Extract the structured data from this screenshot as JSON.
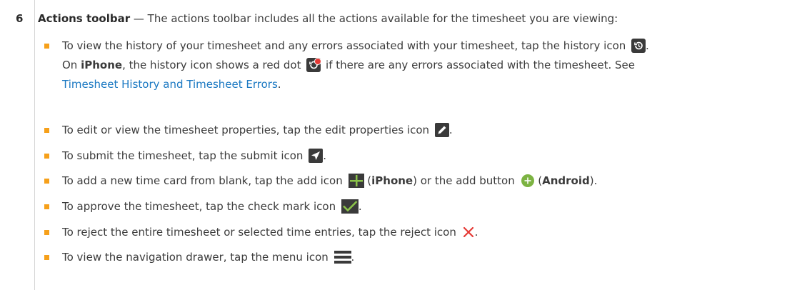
{
  "row_number": "6",
  "intro": {
    "title": "Actions toolbar",
    "rest": " — The actions toolbar includes all the actions available for the timesheet you are viewing:"
  },
  "items": {
    "history": {
      "l1": "To view the history of your timesheet and any errors associated with your timesheet, tap the history icon",
      "l1_end": ".",
      "l2_pre": "On ",
      "l2_bold": "iPhone",
      "l2_mid": ", the history icon shows a red dot",
      "l2_end": " if there are any errors associated with the timesheet. See",
      "link": "Timesheet History and Timesheet Errors",
      "l3_end": "."
    },
    "edit": {
      "text": "To edit or view the timesheet properties, tap the edit properties icon",
      "end": "."
    },
    "submit": {
      "text": "To submit the timesheet, tap the submit icon",
      "end": "."
    },
    "add": {
      "pre": "To add a new time card from blank, tap the add icon",
      "p1": " (",
      "iphone": "iPhone",
      "mid": ") or the add button",
      "p2": " (",
      "android": "Android",
      "end": ")."
    },
    "approve": {
      "text": "To approve the timesheet, tap the check mark icon",
      "end": "."
    },
    "reject": {
      "text": "To reject the entire timesheet or selected time entries, tap the reject icon",
      "end": "."
    },
    "menu": {
      "text": "To view the navigation drawer, tap the menu icon",
      "end": "."
    }
  },
  "colors": {
    "bullet": "#f6a01a",
    "link": "#1a78c2",
    "icon_dark": "#3a3a3a",
    "error_dot": "#e53935",
    "add_green": "#7cb342",
    "reject_red": "#e53935"
  },
  "icons": [
    "history-icon",
    "history-error-icon",
    "edit-properties-icon",
    "submit-icon",
    "add-icon",
    "add-button-icon",
    "check-mark-icon",
    "reject-icon",
    "menu-icon"
  ]
}
